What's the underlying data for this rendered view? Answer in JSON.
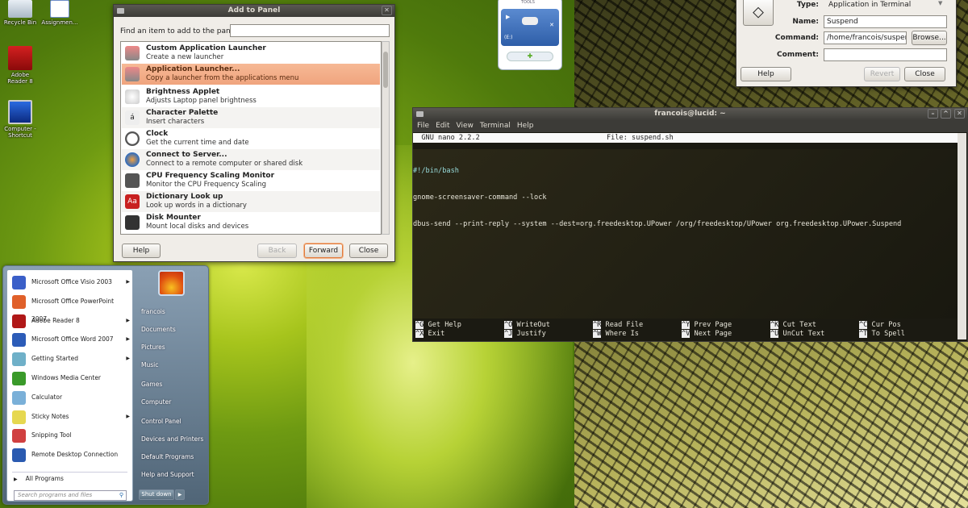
{
  "desktop": {
    "icons": [
      {
        "label": "Recycle Bin"
      },
      {
        "label": "Assignmen..."
      },
      {
        "label": "Adobe Reader 8"
      },
      {
        "label": "Computer - Shortcut"
      }
    ]
  },
  "add_panel": {
    "title": "Add to Panel",
    "find_label": "Find an item to add to the panel:",
    "find_value": "",
    "items": [
      {
        "title": "Custom Application Launcher",
        "desc": "Create a new launcher",
        "icon": "launcher-icon"
      },
      {
        "title": "Application Launcher...",
        "desc": "Copy a launcher from the applications menu",
        "icon": "launcher-icon",
        "selected": true
      },
      {
        "title": "Brightness Applet",
        "desc": "Adjusts Laptop panel brightness",
        "icon": "brightness-icon"
      },
      {
        "title": "Character Palette",
        "desc": "Insert characters",
        "icon": "character-icon",
        "glyph": "á"
      },
      {
        "title": "Clock",
        "desc": "Get the current time and date",
        "icon": "clock-icon"
      },
      {
        "title": "Connect to Server...",
        "desc": "Connect to a remote computer or shared disk",
        "icon": "globe-icon"
      },
      {
        "title": "CPU Frequency Scaling Monitor",
        "desc": "Monitor the CPU Frequency Scaling",
        "icon": "cpu-icon"
      },
      {
        "title": "Dictionary Look up",
        "desc": "Look up words in a dictionary",
        "icon": "dictionary-icon",
        "glyph": "Aa"
      },
      {
        "title": "Disk Mounter",
        "desc": "Mount local disks and devices",
        "icon": "floppy-icon"
      }
    ],
    "buttons": {
      "help": "Help",
      "back": "Back",
      "forward": "Forward",
      "close": "Close"
    }
  },
  "tools_widget": {
    "title": "TOOLS",
    "drive": "(E:)"
  },
  "launcher": {
    "type_label": "Type:",
    "type_value": "Application in Terminal",
    "name_label": "Name:",
    "name_value": "Suspend",
    "command_label": "Command:",
    "command_value": "/home/francois/suspend",
    "comment_label": "Comment:",
    "comment_value": "",
    "browse": "Browse...",
    "help": "Help",
    "revert": "Revert",
    "close": "Close"
  },
  "terminal": {
    "title": "francois@lucid: ~",
    "menu": [
      "File",
      "Edit",
      "View",
      "Terminal",
      "Help"
    ],
    "nano_version": "  GNU nano 2.2.2",
    "nano_file": "File: suspend.sh",
    "lines": [
      "#!/bin/bash",
      "gnome-screensaver-command --lock",
      "dbus-send --print-reply --system --dest=org.freedesktop.UPower /org/freedesktop/UPower org.freedesktop.UPower.Suspend"
    ],
    "shortcuts": [
      [
        "^G",
        "Get Help",
        "^X",
        "Exit"
      ],
      [
        "^O",
        "WriteOut",
        "^J",
        "Justify"
      ],
      [
        "^R",
        "Read File",
        "^W",
        "Where Is"
      ],
      [
        "^Y",
        "Prev Page",
        "^V",
        "Next Page"
      ],
      [
        "^K",
        "Cut Text",
        "^U",
        "UnCut Text"
      ],
      [
        "^C",
        "Cur Pos",
        "^T",
        "To Spell"
      ]
    ]
  },
  "start_menu": {
    "programs": [
      {
        "label": "Microsoft Office Visio 2003",
        "arrow": true,
        "color": "#3a5fc8"
      },
      {
        "label": "Microsoft Office PowerPoint 2007",
        "arrow": false,
        "color": "#e0602a"
      },
      {
        "label": "Adobe Reader 8",
        "arrow": true,
        "color": "#b01818"
      },
      {
        "label": "Microsoft Office Word 2007",
        "arrow": true,
        "color": "#2c5cb8"
      },
      {
        "label": "Getting Started",
        "arrow": true,
        "color": "#6fb0c8"
      },
      {
        "label": "Windows Media Center",
        "arrow": false,
        "color": "#3a9a2a"
      },
      {
        "label": "Calculator",
        "arrow": false,
        "color": "#7ab0d8"
      },
      {
        "label": "Sticky Notes",
        "arrow": true,
        "color": "#e6d850"
      },
      {
        "label": "Snipping Tool",
        "arrow": false,
        "color": "#d04040"
      },
      {
        "label": "Remote Desktop Connection",
        "arrow": false,
        "color": "#2a5ab0"
      }
    ],
    "all_programs": "All Programs",
    "search_placeholder": "Search programs and files",
    "right": [
      "francois",
      "Documents",
      "Pictures",
      "Music",
      "Games",
      "Computer",
      "Control Panel",
      "Devices and Printers",
      "Default Programs",
      "Help and Support"
    ],
    "shutdown": "Shut down"
  }
}
